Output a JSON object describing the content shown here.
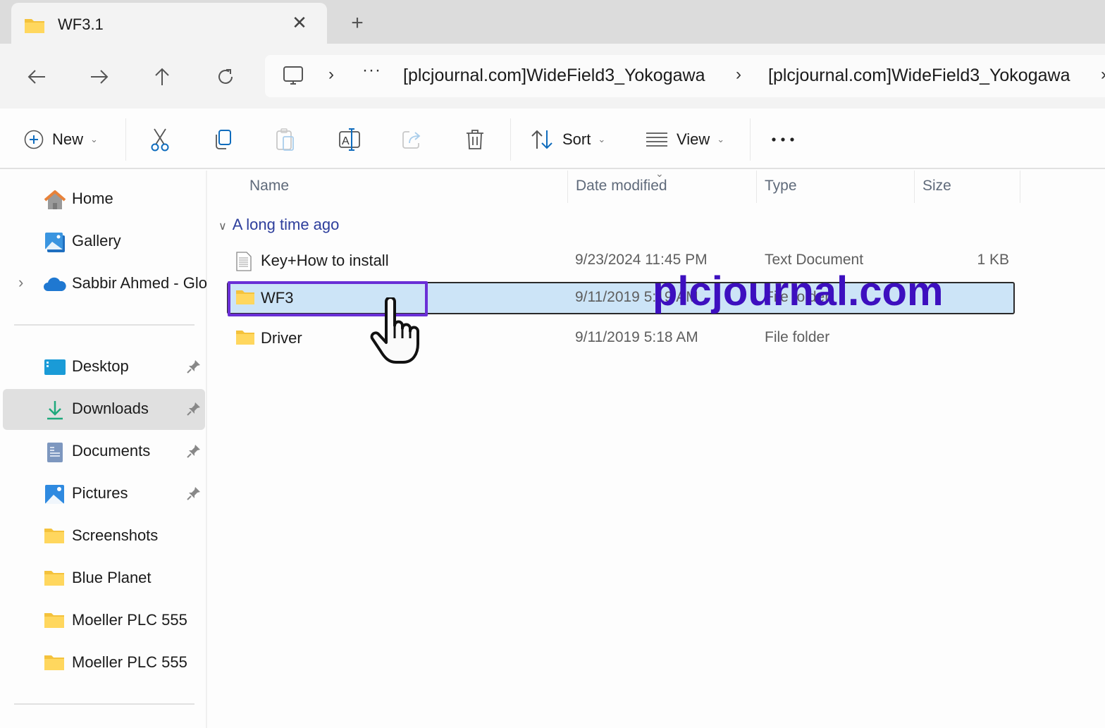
{
  "tab": {
    "title": "WF3.1",
    "icon": "folder-icon",
    "close_icon": "close-icon",
    "new_tab_icon": "plus-icon"
  },
  "nav": {
    "back_icon": "arrow-left-icon",
    "forward_icon": "arrow-right-icon",
    "up_icon": "arrow-up-icon",
    "refresh_icon": "refresh-icon"
  },
  "address": {
    "root_icon": "this-pc-icon",
    "more": "···",
    "crumbs": [
      "[plcjournal.com]WideField3_Yokogawa",
      "[plcjournal.com]WideField3_Yokogawa"
    ],
    "separator": "›"
  },
  "toolbar": {
    "new_label": "New",
    "sort_label": "Sort",
    "view_label": "View",
    "more_label": "•••",
    "icons": [
      "cut-icon",
      "copy-icon",
      "paste-icon",
      "rename-icon",
      "share-icon",
      "delete-icon"
    ]
  },
  "sidebar": {
    "top_items": [
      {
        "label": "Home",
        "icon": "home-icon"
      },
      {
        "label": "Gallery",
        "icon": "gallery-icon"
      },
      {
        "label": "Sabbir Ahmed - Glo",
        "icon": "onedrive-cloud-icon",
        "expandable": true
      }
    ],
    "pinned_items": [
      {
        "label": "Desktop",
        "icon": "desktop-icon",
        "pinned": true
      },
      {
        "label": "Downloads",
        "icon": "download-icon",
        "pinned": true,
        "selected": true
      },
      {
        "label": "Documents",
        "icon": "documents-icon",
        "pinned": true
      },
      {
        "label": "Pictures",
        "icon": "pictures-icon",
        "pinned": true
      },
      {
        "label": "Screenshots",
        "icon": "folder-icon"
      },
      {
        "label": "Blue Planet",
        "icon": "folder-icon"
      },
      {
        "label": "Moeller PLC 555",
        "icon": "folder-icon"
      },
      {
        "label": "Moeller PLC 555",
        "icon": "folder-icon"
      }
    ]
  },
  "filelist": {
    "columns": [
      "Name",
      "Date modified",
      "Type",
      "Size"
    ],
    "sorted_column": "Date modified",
    "group_label": "A long time ago",
    "rows": [
      {
        "name": "Key+How to install",
        "date": "9/23/2024 11:45 PM",
        "type": "Text Document",
        "size": "1 KB",
        "icon": "text-file-icon"
      },
      {
        "name": "WF3",
        "date": "9/11/2019 5:19 AM",
        "type": "File folder",
        "size": "",
        "icon": "folder-icon",
        "selected": true
      },
      {
        "name": "Driver",
        "date": "9/11/2019 5:18 AM",
        "type": "File folder",
        "size": "",
        "icon": "folder-icon"
      }
    ]
  },
  "overlay": {
    "watermark": "plcjournal.com",
    "highlight_color": "#6a2fd6",
    "watermark_color": "#3d0fbf"
  },
  "colors": {
    "selection_bg": "#cce4f7",
    "sidebar_selected_bg": "#e0e0e0",
    "group_header": "#2d3e9c",
    "accent_blue": "#0f6cbd"
  }
}
